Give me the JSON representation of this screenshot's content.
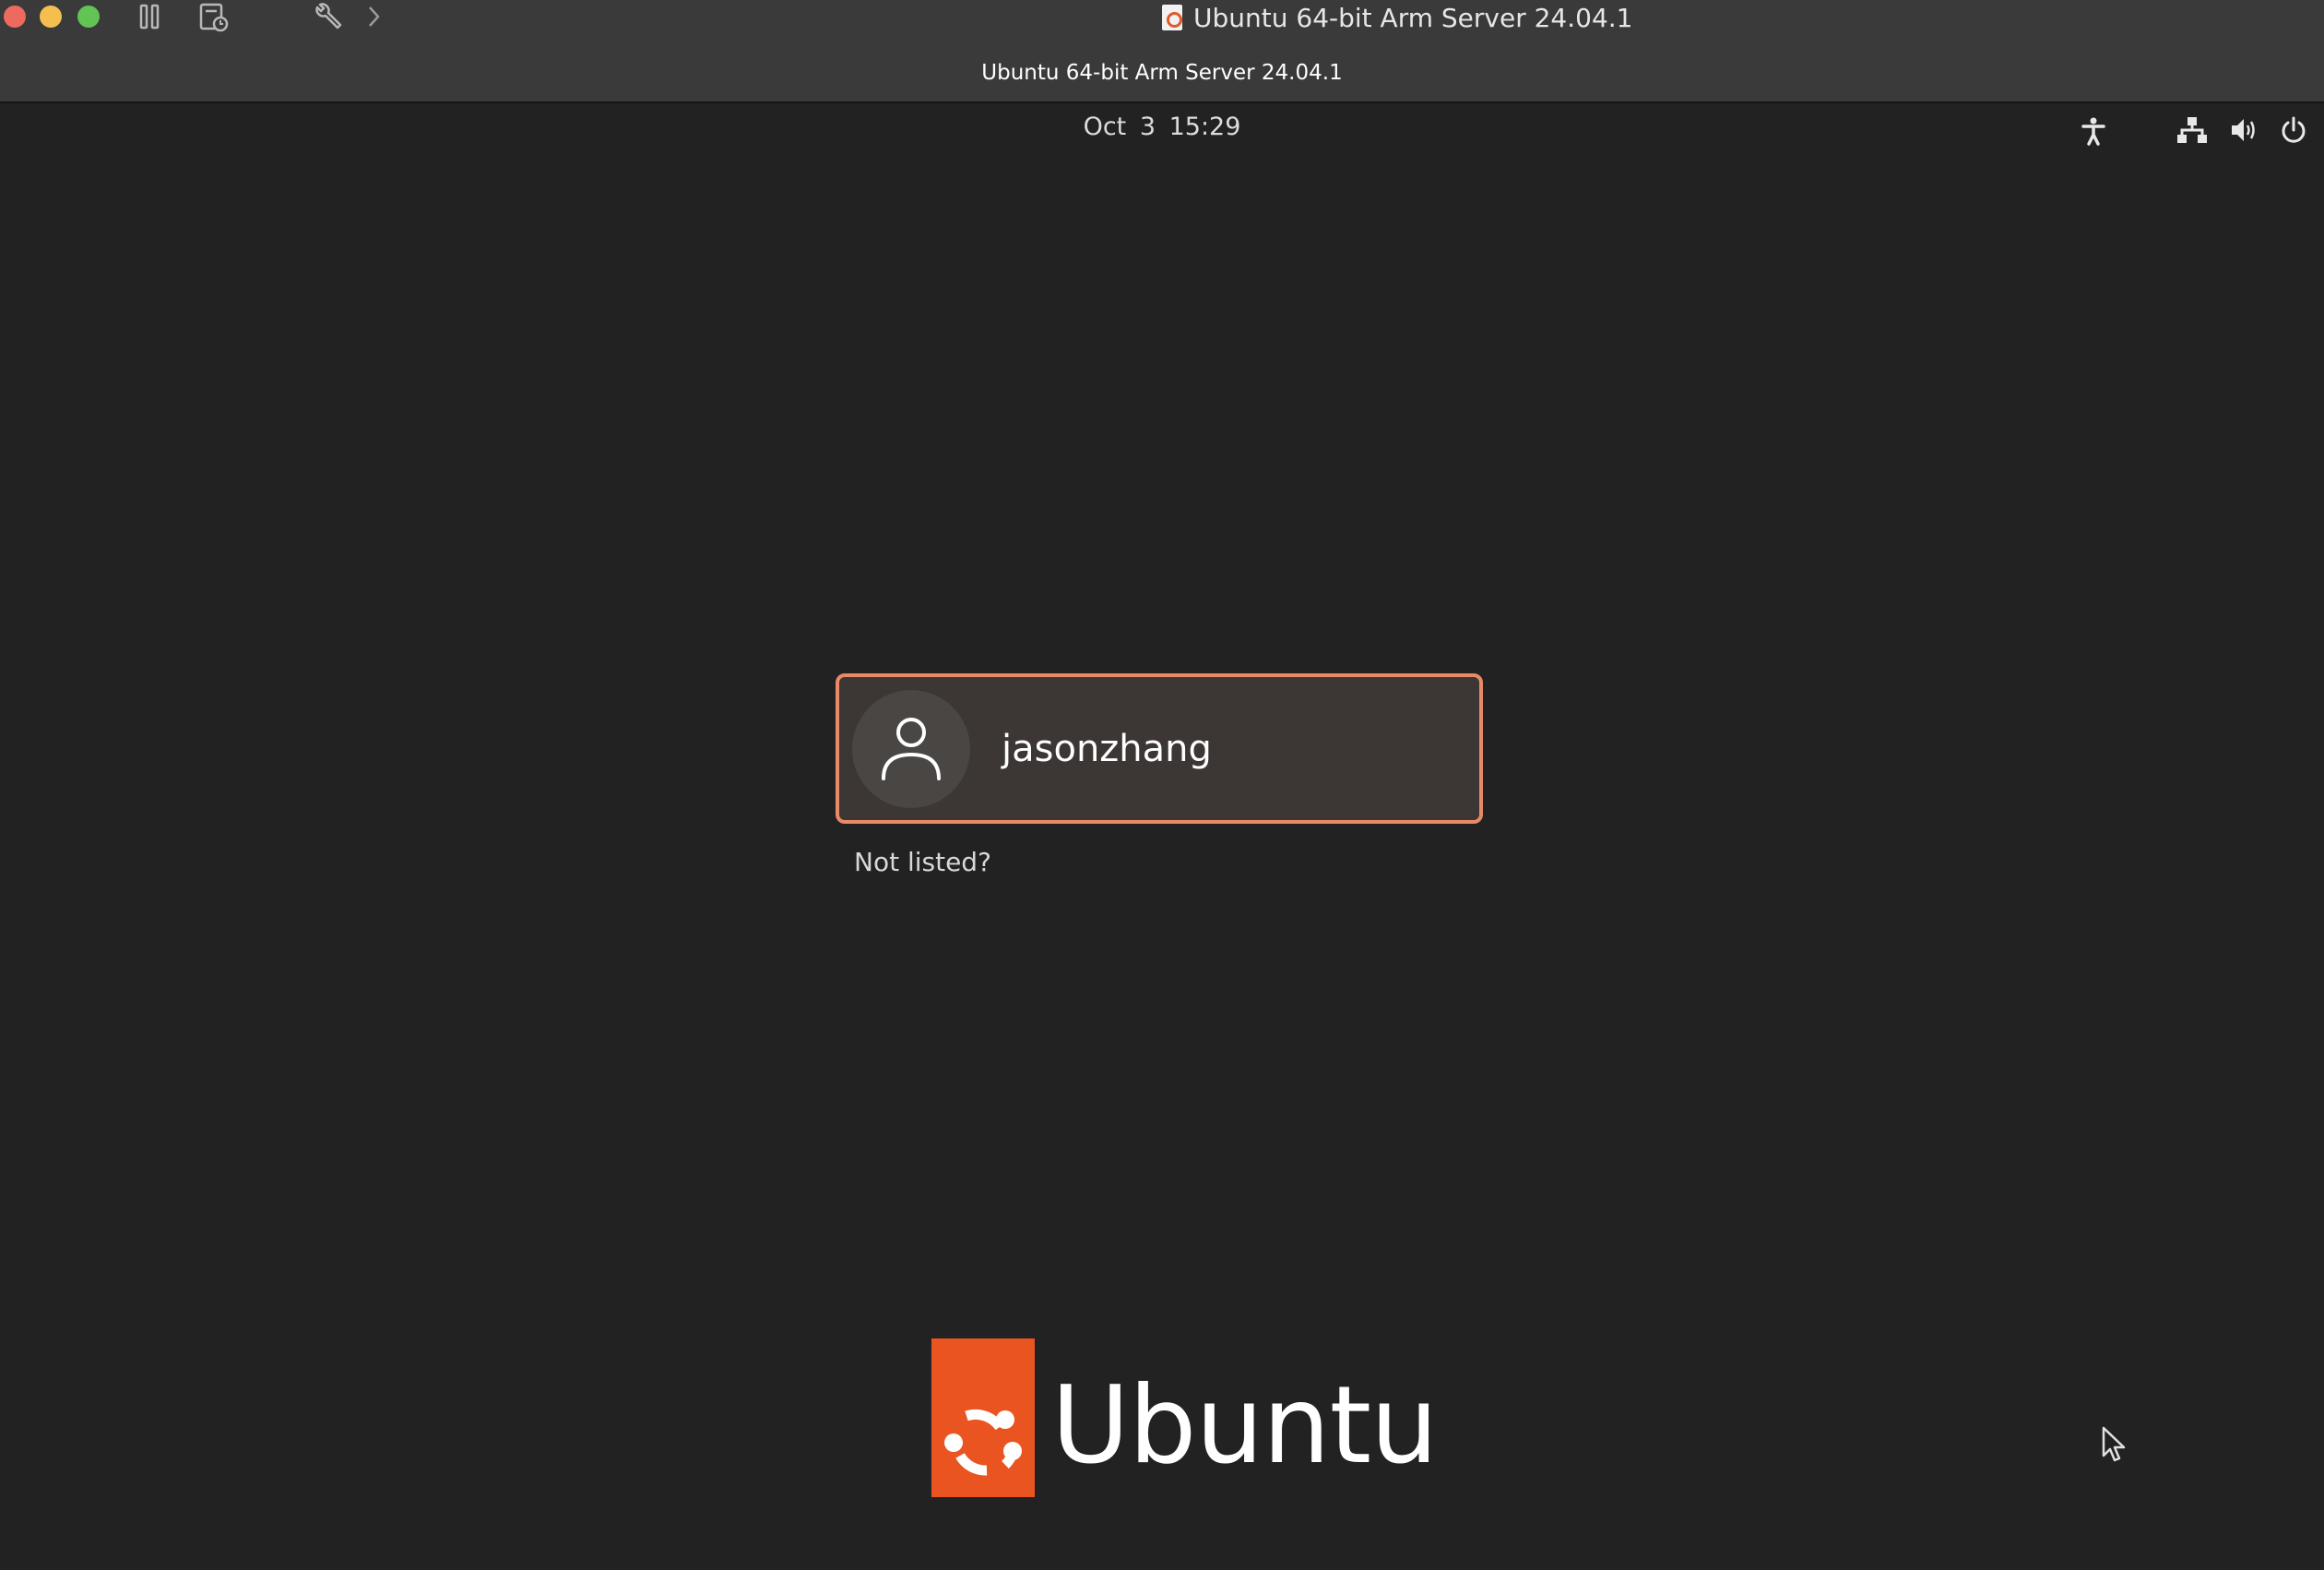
{
  "window": {
    "title": "Ubuntu 64-bit Arm Server 24.04.1",
    "subtitle": "Ubuntu 64-bit Arm Server 24.04.1",
    "toolbar_icons": [
      "pause-icon",
      "snapshot-icon",
      "settings-wrench-icon",
      "chevron-right-icon"
    ]
  },
  "topbar": {
    "clock": "Oct 3  15:29",
    "status_icons": [
      "accessibility-icon",
      "network-icon",
      "volume-icon",
      "power-icon"
    ]
  },
  "login": {
    "username": "jasonzhang",
    "not_listed": "Not listed?"
  },
  "branding": {
    "logo_text": "Ubuntu",
    "accent": "#e95420",
    "focus_border": "#e98a66"
  }
}
